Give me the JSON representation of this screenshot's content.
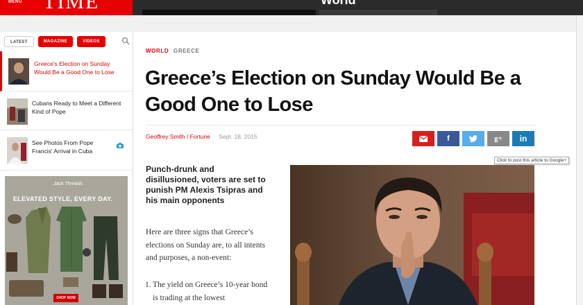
{
  "header": {
    "menu_label": "MENU",
    "logo": "TIME",
    "section": "World"
  },
  "sidebar": {
    "tabs": [
      {
        "label": "LATEST"
      },
      {
        "label": "MAGAZINE"
      },
      {
        "label": "VIDEOS"
      }
    ],
    "items": [
      {
        "title": "Greece's Election on Sunday Would Be a Good One to Lose"
      },
      {
        "title": "Cubans Ready to Meet a Different Kind of Pope"
      },
      {
        "title": "See Photos From Pope Francis' Arrival in Cuba"
      }
    ],
    "ad": {
      "brand": "Jack Threads",
      "headline": "ELEVATED STYLE, EVERY DAY.",
      "button": "SHOP NOW"
    }
  },
  "article": {
    "kicker_section": "WORLD",
    "kicker_topic": "GREECE",
    "headline": "Greece’s Election on Sunday Would Be a Good One to Lose",
    "author": "Geoffrey Smith / Fortune",
    "date": "Sept. 18, 2015",
    "share_tooltip": "Click to post this article to Google+",
    "dek": "Punch-drunk and disillusioned, voters are set to punish PM Alexis Tsipras and his main opponents",
    "body_intro": "Here are three signs that Greece’s elections on Sunday are, to all intents and purposes, a non-event:",
    "list_1_num": "1.",
    "list_1": "The yield on Greece’s 10-year bond is trading at the lowest"
  },
  "colors": {
    "brand_red": "#e60000",
    "email": "#d91e1e",
    "facebook": "#3b5998",
    "twitter": "#55acee",
    "googleplus": "#888888",
    "linkedin": "#1a7bb8"
  }
}
